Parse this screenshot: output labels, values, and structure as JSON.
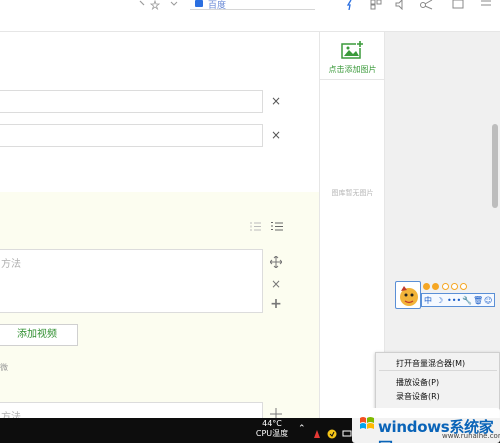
{
  "topbar": {
    "address_text": "百度"
  },
  "editor": {
    "placeholder_method": "方法",
    "add_video_label": "添加视频",
    "micro_label": "微"
  },
  "image_panel": {
    "add_image_label": "点击添加图片",
    "empty_label": "图库暂无图片"
  },
  "qq": {
    "labels": [
      "中",
      "☽",
      "•••"
    ]
  },
  "context_menu": {
    "items": [
      "打开音量混合器(M)",
      "播放设备(P)",
      "录音设备(R)"
    ]
  },
  "taskbar": {
    "temp_value": "44°C",
    "temp_label": "CPU温度"
  },
  "watermark": {
    "brand": "windows系统家园",
    "sub": "www.runaihe.com"
  },
  "colors": {
    "accent_green": "#3a9a3a",
    "taskbar": "#0d0d0d",
    "qq_blue": "#1a5dc8",
    "watermark_blue": "#0a64b8"
  }
}
